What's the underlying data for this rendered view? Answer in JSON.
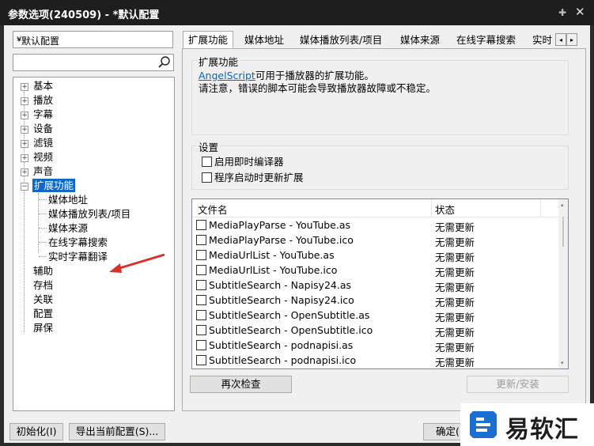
{
  "window": {
    "title": "参数选项(240509) - *默认配置"
  },
  "sidebar": {
    "profile": "*默认配置",
    "search": {
      "value": "",
      "placeholder": ""
    },
    "tree": {
      "basic": "基本",
      "playback": "播放",
      "subtitle": "字幕",
      "device": "设备",
      "filter": "滤镜",
      "video": "视频",
      "audio": "声音",
      "extensions": "扩展功能",
      "ext_children": [
        "媒体地址",
        "媒体播放列表/项目",
        "媒体来源",
        "在线字幕搜索",
        "实时字幕翻译"
      ],
      "assist": "辅助",
      "storage": "存档",
      "association": "关联",
      "config": "配置",
      "screensaver": "屏保"
    }
  },
  "tabs": [
    "扩展功能",
    "媒体地址",
    "媒体播放列表/项目",
    "媒体来源",
    "在线字幕搜索",
    "实时"
  ],
  "tab_scroll": {
    "left": "◂",
    "right": "▸"
  },
  "extensions_panel": {
    "group_title": "扩展功能",
    "link": "AngelScript",
    "desc_rest": "可用于播放器的扩展功能。",
    "warning": "请注意，错误的脚本可能会导致播放器故障或不稳定。",
    "settings_title": "设置",
    "checkboxes": [
      "启用即时编译器",
      "程序启动时更新扩展"
    ],
    "list": {
      "col_name": "文件名",
      "col_status": "状态",
      "rows": [
        {
          "name": "MediaPlayParse - YouTube.as",
          "status": "无需更新"
        },
        {
          "name": "MediaPlayParse - YouTube.ico",
          "status": "无需更新"
        },
        {
          "name": "MediaUrlList - YouTube.as",
          "status": "无需更新"
        },
        {
          "name": "MediaUrlList - YouTube.ico",
          "status": "无需更新"
        },
        {
          "name": "SubtitleSearch - Napisy24.as",
          "status": "无需更新"
        },
        {
          "name": "SubtitleSearch - Napisy24.ico",
          "status": "无需更新"
        },
        {
          "name": "SubtitleSearch - OpenSubtitle.as",
          "status": "无需更新"
        },
        {
          "name": "SubtitleSearch - OpenSubtitle.ico",
          "status": "无需更新"
        },
        {
          "name": "SubtitleSearch - podnapisi.as",
          "status": "无需更新"
        },
        {
          "name": "SubtitleSearch - podnapisi.ico",
          "status": "无需更新"
        }
      ]
    },
    "recheck_button": "再次检查",
    "update_button": "更新/安装"
  },
  "footer": {
    "init_button": "初始化(I)",
    "export_button": "导出当前配置(S)...",
    "ok_button": "确定("
  },
  "watermark": {
    "text": "易软汇"
  },
  "colors": {
    "selection": "#0f67c7",
    "link": "#0066cc",
    "arrow": "#d9302a",
    "titlebar": "#1e1e1e"
  }
}
